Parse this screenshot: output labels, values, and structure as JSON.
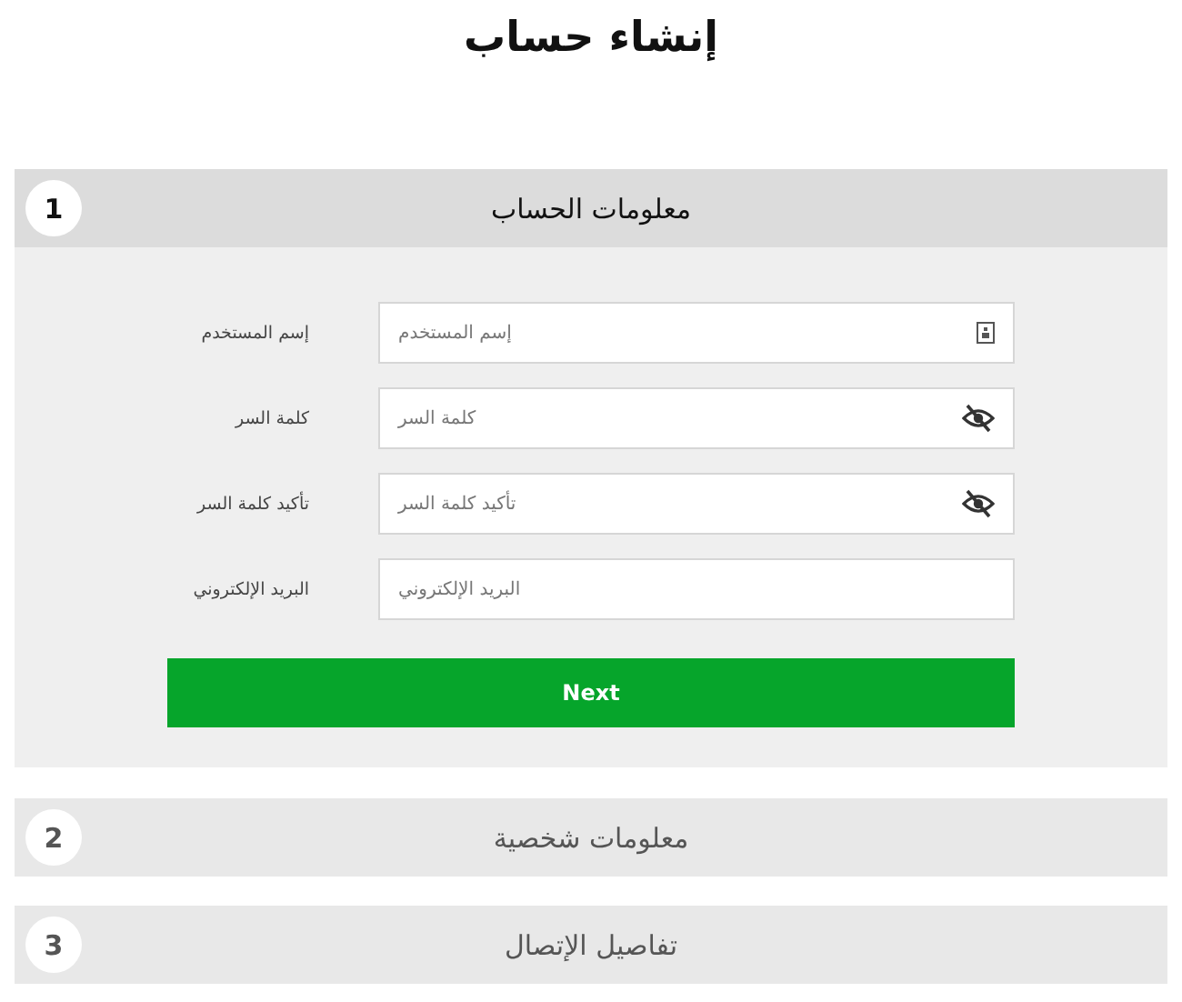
{
  "title": "إنشاء حساب",
  "sections": [
    {
      "number": "1",
      "title": "معلومات الحساب",
      "expanded": true,
      "fields": [
        {
          "label": "إسم المستخدم",
          "placeholder": "إسم المستخدم",
          "kind": "id"
        },
        {
          "label": "كلمة السر",
          "placeholder": "كلمة السر",
          "kind": "password"
        },
        {
          "label": "تأكيد كلمة السر",
          "placeholder": "تأكيد كلمة السر",
          "kind": "password"
        },
        {
          "label": "البريد الإلكتروني",
          "placeholder": "البريد الإلكتروني",
          "kind": "email"
        }
      ],
      "button": "Next"
    },
    {
      "number": "2",
      "title": "معلومات شخصية",
      "expanded": false
    },
    {
      "number": "3",
      "title": "تفاصيل الإتصال",
      "expanded": false
    }
  ]
}
